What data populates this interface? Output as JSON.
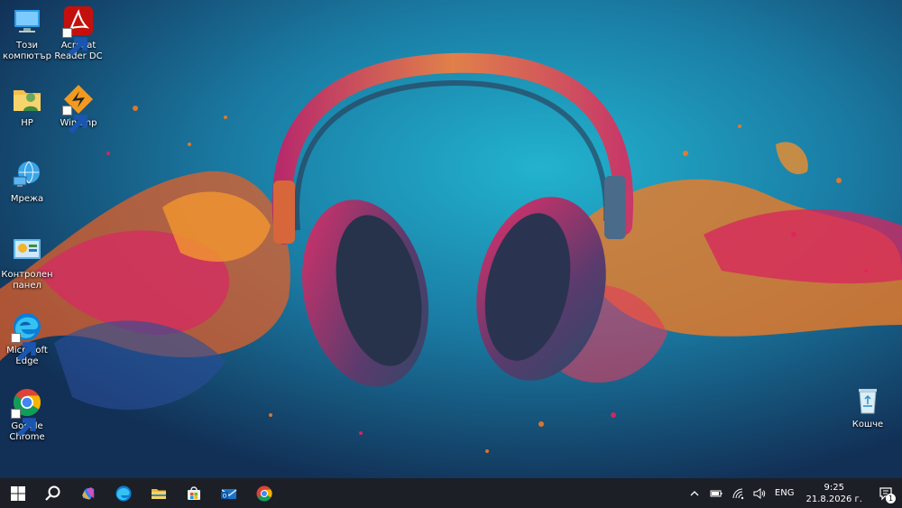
{
  "desktop": {
    "icons": [
      {
        "label": "Този компютър",
        "icon": "computer-icon"
      },
      {
        "label": "Acrobat Reader DC",
        "icon": "acrobat-icon"
      },
      {
        "label": "HP",
        "icon": "user-folder-icon"
      },
      {
        "label": "Winamp",
        "icon": "winamp-icon"
      },
      {
        "label": "Мрежа",
        "icon": "network-icon"
      },
      {
        "label": "Контролен панел",
        "icon": "control-panel-icon"
      },
      {
        "label": "Microsoft Edge",
        "icon": "edge-icon"
      },
      {
        "label": "Google Chrome",
        "icon": "chrome-icon"
      },
      {
        "label": "Кошче",
        "icon": "recycle-bin-icon"
      }
    ]
  },
  "taskbar": {
    "pinned": [
      "start-icon",
      "search-icon",
      "copilot-icon",
      "edge-icon",
      "file-explorer-icon",
      "store-icon",
      "mail-icon",
      "chrome-icon"
    ],
    "tray": {
      "language": "ENG",
      "time": "9:25",
      "date": "21.8.2026 г.",
      "notification_count": "1"
    }
  },
  "colors": {
    "taskbar_bg": "#1c1f26",
    "accent_orange": "#f0771e",
    "accent_magenta": "#d8245f"
  }
}
